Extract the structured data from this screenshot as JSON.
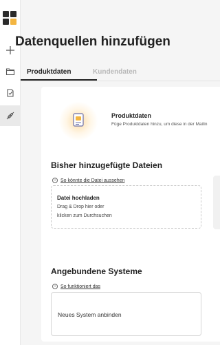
{
  "page": {
    "title": "Datenquellen hinzufügen"
  },
  "sidebar": {
    "items": [
      {
        "name": "add",
        "icon": "plus-icon"
      },
      {
        "name": "folder",
        "icon": "folder-icon"
      },
      {
        "name": "checklist",
        "icon": "document-check-icon"
      },
      {
        "name": "connections",
        "icon": "plug-icon",
        "active": true
      }
    ]
  },
  "tabs": [
    {
      "label": "Produktdaten",
      "active": true
    },
    {
      "label": "Kundendaten",
      "active": false
    }
  ],
  "intro": {
    "title": "Produktdaten",
    "description": "Füge Produktdaten hinzu, um diese in der Mailin"
  },
  "files": {
    "title": "Bisher hinzugefügte Dateien",
    "hint": "So könnte die Datei aussehen",
    "upload": {
      "title": "Datei hochladen",
      "line1": "Drag & Drop hier oder",
      "line2": "klicken zum Durchsuchen"
    }
  },
  "systems": {
    "title": "Angebundene Systeme",
    "hint": "So funktioniert das",
    "connect_label": "Neues System anbinden"
  },
  "colors": {
    "accent": "#f3b541",
    "sidebar_active": "#e9e9e9",
    "tab_active": "#222222",
    "tab_inactive": "#b8b8b8"
  }
}
